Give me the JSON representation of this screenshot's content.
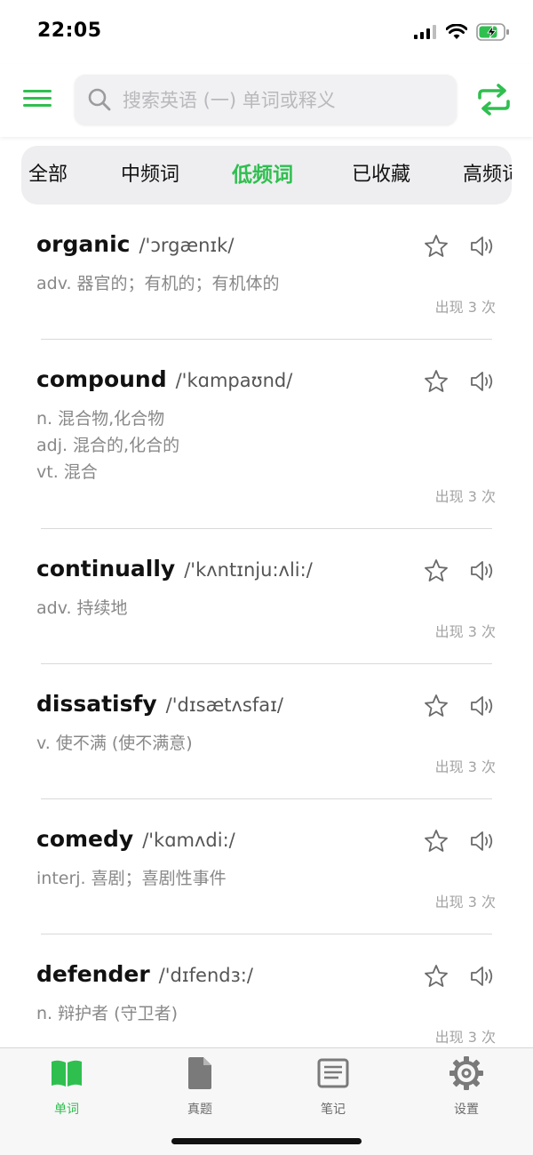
{
  "status_bar": {
    "time": "22:05"
  },
  "search": {
    "placeholder": "搜索英语 (一) 单词或释义"
  },
  "tabs": [
    {
      "label": "全部",
      "active": false
    },
    {
      "label": "中频词",
      "active": false
    },
    {
      "label": "低频词",
      "active": true
    },
    {
      "label": "已收藏",
      "active": false
    },
    {
      "label": "高频词",
      "active": false
    }
  ],
  "words": [
    {
      "word": "organic",
      "phonetic": "/'ɔrgænɪk/",
      "definitions": [
        "adv. 器官的；有机的；有机体的"
      ],
      "count": "出现 3 次"
    },
    {
      "word": "compound",
      "phonetic": "/'kɑmpaʊnd/",
      "definitions": [
        "n. 混合物,化合物",
        "adj. 混合的,化合的",
        "vt. 混合"
      ],
      "count": "出现 3 次"
    },
    {
      "word": "continually",
      "phonetic": "/'kʌntɪnju:ʌli:/",
      "definitions": [
        "adv. 持续地"
      ],
      "count": "出现 3 次"
    },
    {
      "word": "dissatisfy",
      "phonetic": "/'dɪsætʌsfaɪ/",
      "definitions": [
        "v. 使不满 (使不满意)"
      ],
      "count": "出现 3 次"
    },
    {
      "word": "comedy",
      "phonetic": "/'kɑmʌdi:/",
      "definitions": [
        "interj. 喜剧；喜剧性事件"
      ],
      "count": "出现 3 次"
    },
    {
      "word": "defender",
      "phonetic": "/'dɪfendɜ:/",
      "definitions": [
        "n. 辩护者 (守卫者)"
      ],
      "count": "出现 3 次"
    }
  ],
  "tabbar": [
    {
      "label": "单词",
      "icon": "book-icon",
      "active": true
    },
    {
      "label": "真题",
      "icon": "document-icon",
      "active": false
    },
    {
      "label": "笔记",
      "icon": "notes-icon",
      "active": false
    },
    {
      "label": "设置",
      "icon": "gear-icon",
      "active": false
    }
  ],
  "colors": {
    "accent": "#2fbf4f",
    "inactive_icon": "#7a7a7a",
    "secondary_text": "#888888"
  }
}
